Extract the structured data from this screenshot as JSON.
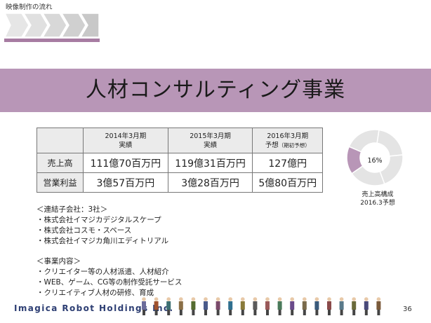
{
  "breadcrumb": {
    "label": "映像制作の流れ"
  },
  "title": "人材コンサルティング事業",
  "table": {
    "headers": [
      {
        "line1": "2014年3月期",
        "line2": "実績",
        "note": ""
      },
      {
        "line1": "2015年3月期",
        "line2": "実績",
        "note": ""
      },
      {
        "line1": "2016年3月期",
        "line2": "予想",
        "note": "（期初予想）"
      }
    ],
    "rows": [
      {
        "label": "売上高",
        "values": [
          "111億70百万円",
          "119億31百万円",
          "127億円"
        ]
      },
      {
        "label": "営業利益",
        "values": [
          "3億57百万円",
          "3億28百万円",
          "5億80百万円"
        ]
      }
    ]
  },
  "donut": {
    "percent_label": "16%",
    "share": 0.16,
    "caption_line1": "売上高構成",
    "caption_line2": "2016.3予想",
    "colors": {
      "highlight": "#b896b7",
      "rest": "#e4e4e4"
    }
  },
  "notes": {
    "subsidiaries_heading": "＜連結子会社：3社＞",
    "subsidiaries": [
      "・株式会社イマジカデジタルスケープ",
      "・株式会社コスモ・スペース",
      "・株式会社イマジカ角川エディトリアル"
    ],
    "business_heading": "＜事業内容＞",
    "business": [
      "・クリエイター等の人材派遣、人材紹介",
      "・WEB、ゲーム、CG等の制作受託サービス",
      "・クリエイティブ人材の研修、育成"
    ]
  },
  "footer": {
    "logo_text": "Imagica Robot Holdings Inc.",
    "page_number": "36"
  },
  "theme": {
    "accent": "#b896b7",
    "flow_gray": "#cfcfcf"
  }
}
